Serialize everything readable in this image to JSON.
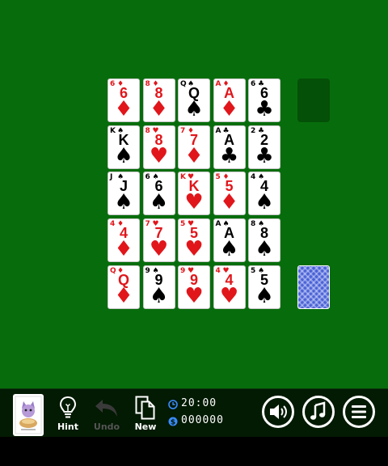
{
  "tableau": [
    [
      {
        "rank": "6",
        "suit": "♦",
        "color": "red"
      },
      {
        "rank": "8",
        "suit": "♦",
        "color": "red"
      },
      {
        "rank": "Q",
        "suit": "♠",
        "color": "black"
      },
      {
        "rank": "A",
        "suit": "♦",
        "color": "red"
      },
      {
        "rank": "6",
        "suit": "♣",
        "color": "black"
      }
    ],
    [
      {
        "rank": "K",
        "suit": "♠",
        "color": "black"
      },
      {
        "rank": "8",
        "suit": "♥",
        "color": "red"
      },
      {
        "rank": "7",
        "suit": "♦",
        "color": "red"
      },
      {
        "rank": "A",
        "suit": "♣",
        "color": "black"
      },
      {
        "rank": "2",
        "suit": "♣",
        "color": "black"
      }
    ],
    [
      {
        "rank": "J",
        "suit": "♠",
        "color": "black"
      },
      {
        "rank": "6",
        "suit": "♠",
        "color": "black"
      },
      {
        "rank": "K",
        "suit": "♥",
        "color": "red"
      },
      {
        "rank": "5",
        "suit": "♦",
        "color": "red"
      },
      {
        "rank": "4",
        "suit": "♠",
        "color": "black"
      }
    ],
    [
      {
        "rank": "4",
        "suit": "♦",
        "color": "red"
      },
      {
        "rank": "7",
        "suit": "♥",
        "color": "red"
      },
      {
        "rank": "5",
        "suit": "♥",
        "color": "red"
      },
      {
        "rank": "A",
        "suit": "♠",
        "color": "black"
      },
      {
        "rank": "8",
        "suit": "♠",
        "color": "black"
      }
    ],
    [
      {
        "rank": "Q",
        "suit": "♦",
        "color": "red"
      },
      {
        "rank": "9",
        "suit": "♠",
        "color": "black"
      },
      {
        "rank": "9",
        "suit": "♥",
        "color": "red"
      },
      {
        "rank": "4",
        "suit": "♥",
        "color": "red"
      },
      {
        "rank": "5",
        "suit": "♠",
        "color": "black"
      }
    ]
  ],
  "toolbar": {
    "hint_label": "Hint",
    "undo_label": "Undo",
    "new_label": "New",
    "timer": "20:00",
    "score": "000000",
    "undo_enabled": false
  },
  "colors": {
    "felt": "#076d0c",
    "card_red": "#e0161b",
    "card_black": "#000000",
    "card_back": "#4a62d8"
  }
}
